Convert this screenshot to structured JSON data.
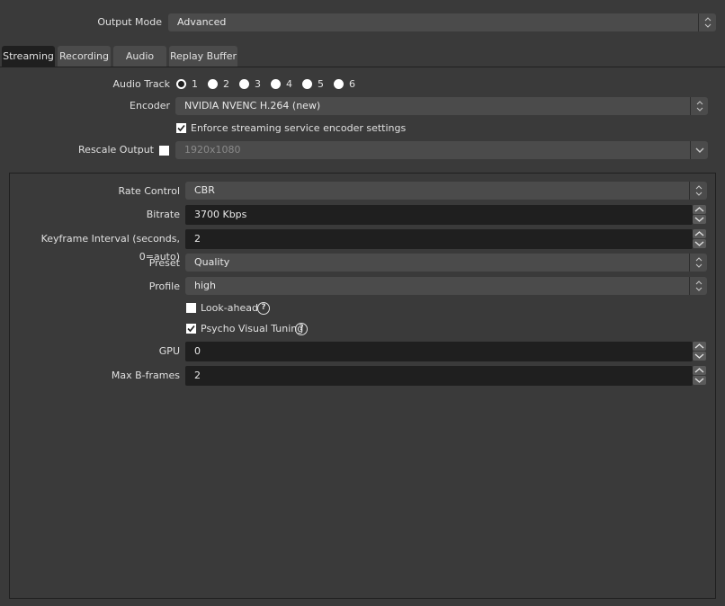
{
  "output_mode": {
    "label": "Output Mode",
    "value": "Advanced"
  },
  "tabs": [
    {
      "label": "Streaming",
      "active": true
    },
    {
      "label": "Recording",
      "active": false
    },
    {
      "label": "Audio",
      "active": false
    },
    {
      "label": "Replay Buffer",
      "active": false
    }
  ],
  "streaming": {
    "audio_track": {
      "label": "Audio Track",
      "options": [
        "1",
        "2",
        "3",
        "4",
        "5",
        "6"
      ],
      "selected": "1"
    },
    "encoder": {
      "label": "Encoder",
      "value": "NVIDIA NVENC H.264 (new)"
    },
    "enforce": {
      "label": "Enforce streaming service encoder settings",
      "checked": true
    },
    "rescale": {
      "label": "Rescale Output",
      "checked": false,
      "value": "1920x1080"
    }
  },
  "encoder_settings": {
    "rate_control": {
      "label": "Rate Control",
      "value": "CBR"
    },
    "bitrate": {
      "label": "Bitrate",
      "value": "3700 Kbps"
    },
    "keyframe": {
      "label": "Keyframe Interval (seconds, 0=auto)",
      "value": "2"
    },
    "preset": {
      "label": "Preset",
      "value": "Quality"
    },
    "profile": {
      "label": "Profile",
      "value": "high"
    },
    "lookahead": {
      "label": "Look-ahead",
      "checked": false
    },
    "psycho": {
      "label": "Psycho Visual Tuning",
      "checked": true
    },
    "gpu": {
      "label": "GPU",
      "value": "0"
    },
    "bframes": {
      "label": "Max B-frames",
      "value": "2"
    }
  },
  "icons": {
    "help": "?"
  }
}
